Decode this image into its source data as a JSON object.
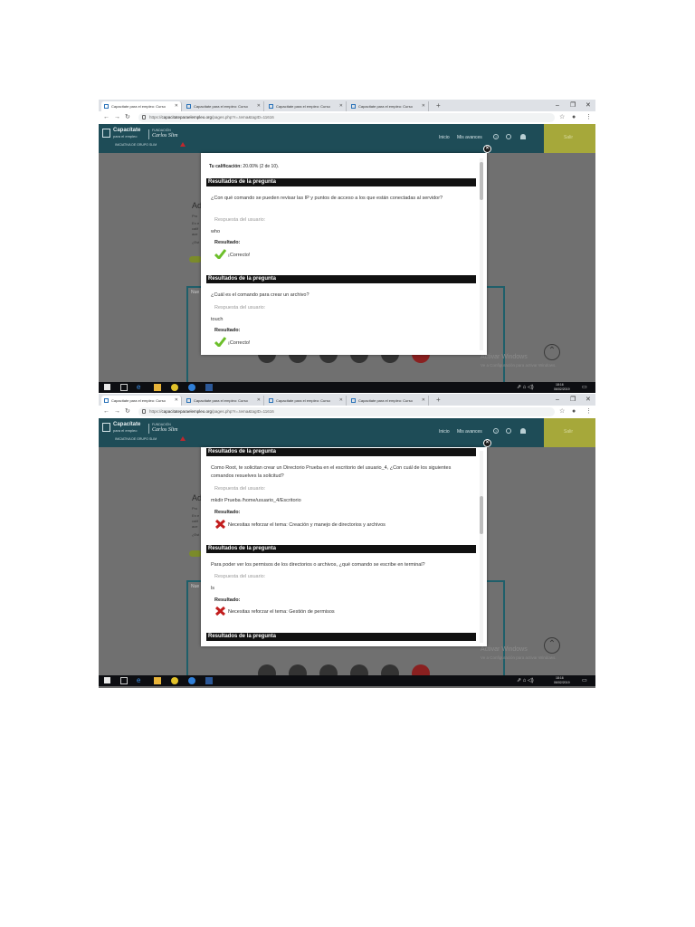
{
  "browser": {
    "tabs": [
      "Capacítate para el empleo: Curso",
      "Capacítate para el empleo: Curso",
      "Capacítate para el empleo: Curso",
      "Capacítate para el empleo: Curso"
    ],
    "url_prefix": "https://",
    "url_domain": "capacitateparaelempleo.org",
    "url_path": "/pages.php?r=.tema&tagID=11616"
  },
  "site": {
    "logo_line1": "Capacítate",
    "logo_line2": "para el empleo",
    "logo_line3": "INICIATIVA DE GRUPO SLIM",
    "logo_foundation_1": "FUNDACIÓN",
    "logo_foundation_2": "Carlos Slim",
    "nav_inicio": "Inicio",
    "nav_avances": "Mis avances",
    "olive_label": "Salir"
  },
  "background": {
    "heading": "Ad",
    "panel_title": "Nue",
    "watermark_title": "Activar Windows",
    "watermark_sub": "Ve a Configuración para activar Windows."
  },
  "taskbar": {
    "time": "18:16",
    "date": "06/02/2019"
  },
  "modal": {
    "grade_label": "Tu calificación:",
    "grade_value": "20.00% (2 de 10).",
    "results_header": "Resultados de la pregunta",
    "user_answer_label": "Respuesta del usuario:",
    "result_label": "Resultado:",
    "q1": {
      "question": "¿Con qué comando se pueden revisar las IP y puntos de acceso a los que están conectadas al servidor?",
      "answer": "who",
      "result": "¡Correcto!"
    },
    "q2": {
      "question": "¿Cuál es el comando para crear un archivo?",
      "answer": "touch",
      "result": "¡Correcto!"
    },
    "q3": {
      "question": "Como Root, te solicitan crear un Directorio Prueba en el escritorio del usuario_4, ¿Con cuál de los siguientes comandos resuelves la solicitud?",
      "answer": "mkdir Prueba /home/usuario_4/Escritorio",
      "result": "Necesitas reforzar el tema: Creación y manejo de directorios y archivos"
    },
    "q4": {
      "question": "Para poder ver los permisos de los directorios o archivos, ¿qué comando se escribe en terminal?",
      "answer": "ls",
      "result": "Necesitas reforzar el tema: Gestión de permisos"
    }
  },
  "colors": {
    "header": "#1e4c57",
    "olive": "#a6a83a",
    "correct": "#6cbf2a",
    "incorrect": "#c21d1d",
    "taskbar": "#0d0e12"
  }
}
